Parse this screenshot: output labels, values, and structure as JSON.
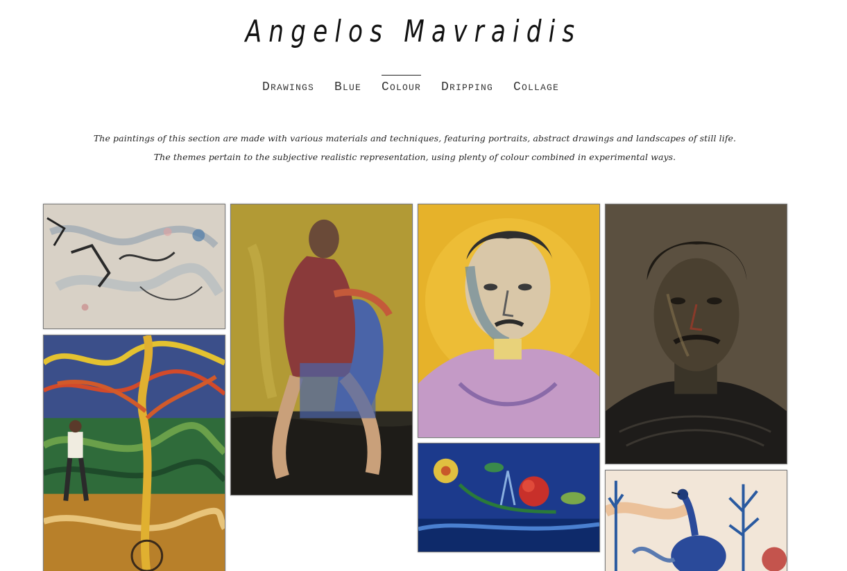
{
  "site": {
    "title": "Angelos Mavraidis"
  },
  "nav": {
    "items": [
      {
        "label": "Drawings"
      },
      {
        "label": "Blue"
      },
      {
        "label": "Colour"
      },
      {
        "label": "Dripping"
      },
      {
        "label": "Collage"
      }
    ],
    "active": "Colour"
  },
  "intro": {
    "line1": "The paintings of this section are made with various materials and techniques, featuring portraits, abstract drawings and landscapes of still life.",
    "line2": "The themes pertain to the subjective realistic representation, using plenty of colour combined in experimental ways."
  },
  "gallery": {
    "artworks": [
      {
        "name": "abstract-grey-painting",
        "palette": [
          "#d9d2c8",
          "#6d8aa6",
          "#2b2b2b"
        ]
      },
      {
        "name": "seated-figure-painting",
        "palette": [
          "#b39a34",
          "#5a6ea8",
          "#4a2a26"
        ]
      },
      {
        "name": "yellow-portrait-painting",
        "palette": [
          "#e6b42a",
          "#c89ac8",
          "#3a3a3a"
        ]
      },
      {
        "name": "dark-self-portrait-drawing",
        "palette": [
          "#5b5040",
          "#2a251e",
          "#8a7a5a"
        ]
      },
      {
        "name": "tree-and-figure-painting",
        "palette": [
          "#3a7a3a",
          "#d9a830",
          "#2a4a8a"
        ]
      },
      {
        "name": "blue-still-life-painting",
        "palette": [
          "#1a3a8a",
          "#c8302a",
          "#e0c040"
        ]
      },
      {
        "name": "blue-bird-painting",
        "palette": [
          "#f0e4d6",
          "#2a5aa0",
          "#c8a080"
        ]
      }
    ]
  }
}
